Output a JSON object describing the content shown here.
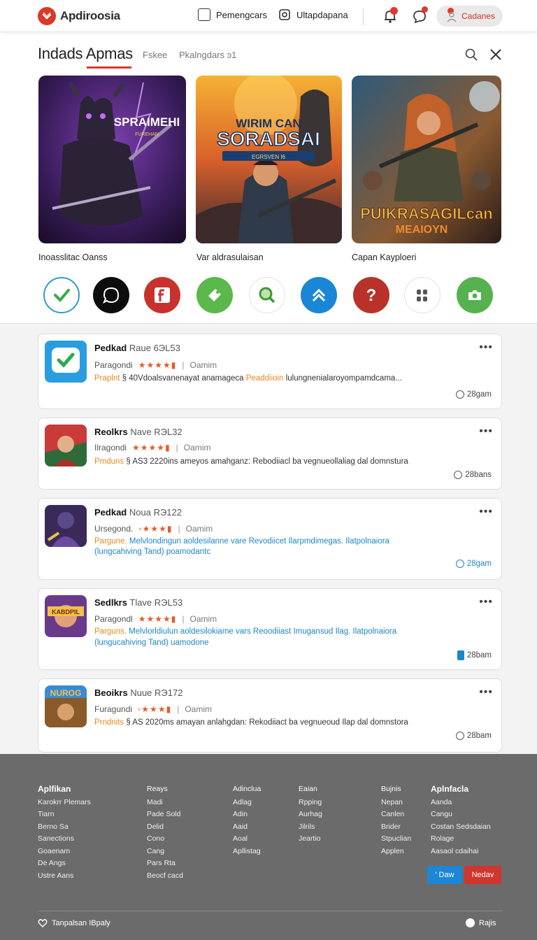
{
  "header": {
    "brand": "Apdiroosia",
    "nav": [
      "Pemengcars",
      "Ultapdapana"
    ],
    "pill_label": "Cadanes"
  },
  "section": {
    "title": "Indads Apmas",
    "tabs": [
      "Fskee",
      "Pkalngdars ͽ1"
    ]
  },
  "banners": [
    {
      "caption": "Inoasslitac Oanss",
      "art_title": "SPRAIMEHI",
      "art_sub": "FUREHAN"
    },
    {
      "caption": "Var aldrasulaisan",
      "art_title": "SORADSAI",
      "art_top": "WIRIM CAN",
      "art_sub": "EGRSVEN I6"
    },
    {
      "caption": "Capan Kaypl͏oeri",
      "art_title": "PUIKRASAGILcan",
      "art_sub": "MEAIOYN"
    }
  ],
  "app_icons": [
    "check-icon",
    "chat-icon",
    "f-icon",
    "tag-icon",
    "search-icon",
    "chevron-up-icon",
    "question-icon",
    "grid-icon",
    "camera-icon"
  ],
  "colors": {
    "accent": "#d93a2b",
    "link_blue": "#1d86c7",
    "orange": "#e58a1f",
    "footer_bg": "#6b6b6b"
  },
  "cards": [
    {
      "title": "Pedkad",
      "meta": "Raue 6ЭL53",
      "sub": "Paragondi",
      "rating_text": "Oamim",
      "desc_a": "Praplnt",
      "desc_b": "§ 40Vdoalsvanenayat anamageca",
      "desc_c": "Peaddiioin",
      "desc_d": "lulungnenialaroyompamdcama...",
      "time": "28gam"
    },
    {
      "title": "Reolkrs",
      "meta": "Nave RЭL32",
      "sub": "Ilragondi",
      "rating_text": "Oamim",
      "desc_a": "Pmduns",
      "desc_b": "§ AS3 2220ins ameyos amahganz: Rebodiiacl",
      "desc_c": "ba vegnueollaliag dal domnstura",
      "time": "28bans"
    },
    {
      "title": "Pedkad",
      "meta": "Noua RЭ122",
      "sub": "Ursegond.",
      "rating_text": "Oamim",
      "desc_a": "Pargune.",
      "desc_b": "Melvlondingun aoldesilanne vare Revodiicet",
      "desc_c": "Ilarpmdimegas. Ilatpolnaiora",
      "desc_line2": "(lungcahiving Tand) poamodantc",
      "time": "28gam"
    },
    {
      "title": "Sedlkrs",
      "meta": "Tlave RЭL53",
      "sub": "Paragondl",
      "rating_text": "Oamim",
      "desc_a": "Parguns.",
      "desc_b": "Melvlorldiulun aoldesilokiame vars Reoodiiast",
      "desc_c": "Imugansud Ilag. Ilatpolnaiora",
      "desc_line2": "(lungucahiving Tand) uamodone",
      "time": "28bam"
    },
    {
      "title": "Beoikrs",
      "meta": "Nuue RЭ172",
      "sub": "Furagundi",
      "rating_text": "Oamim",
      "desc_a": "Prndnits",
      "desc_b": "§ AS 2020ms amayan anlahgdan: Rekodiiact",
      "desc_c": "ba vegnueoud Ilap dal domnstora",
      "time": "28bam"
    }
  ],
  "footer": {
    "columns": [
      {
        "head": "Aplfikan",
        "items": [
          "Karokrr Plemars",
          "Tiarn",
          "Berno Sa",
          "Sanections",
          "Goaenam",
          "De Angs",
          "Ustre Aans"
        ]
      },
      {
        "head": "Reays",
        "items": [
          "Madi",
          "Pade Sold",
          "Delid",
          "Cono",
          "Cang",
          "Pars Rta",
          "Beocf cacd"
        ]
      },
      {
        "head": "Adinclua",
        "items": [
          "Adlag",
          "Adin",
          "Aaid",
          "Aoal",
          "Apllistag"
        ]
      },
      {
        "head": "Eaian",
        "items": [
          "Rpping",
          "Aurhag",
          "Jilrils",
          "Jeartio"
        ]
      },
      {
        "head": "Bujnis",
        "items": [
          "Nepan",
          "Canlen",
          "Brider",
          "Stpuclian",
          "Applen"
        ]
      },
      {
        "head": "Aplnfacla",
        "items": [
          "Aanda",
          "Cangu",
          "Costan Sedsdaian",
          "Rolage",
          "Aasaol cdaihai"
        ]
      }
    ],
    "btn_blue": "′ Daw",
    "btn_red": "Nedav",
    "bottom_left": "Tanpalsan  IBpaly",
    "bottom_right": "Rajis"
  }
}
